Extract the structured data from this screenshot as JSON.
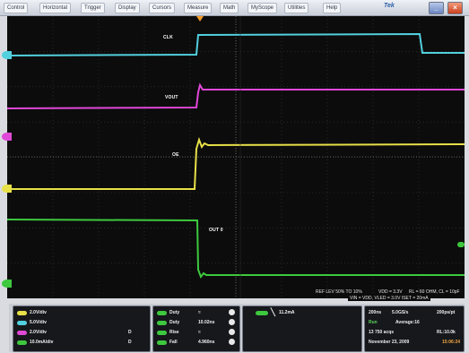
{
  "menu": {
    "items": [
      "Control",
      "Horizontal",
      "Trigger",
      "Display",
      "Cursors",
      "Measure",
      "Math",
      "MyScope",
      "Utilities",
      "Help"
    ],
    "brand": "Tek"
  },
  "colors": {
    "ch1": "#52d0de",
    "ch2": "#e048d8",
    "ch3": "#e8e048",
    "ch4": "#3ec83e"
  },
  "traces": {
    "clk_label": "CLK",
    "vout_label": "VOUT",
    "oe_label": "OE",
    "out_label": "OUT 0"
  },
  "notes": {
    "ref_lev": "REF LEV 50% TO 10%",
    "vdd": "VDD = 3.3V",
    "rl": "RL = 60 OHM, CL = 10pF",
    "vin": "VIN = VDD, VLED = 3.0V  ISET = 20mA"
  },
  "channels": [
    {
      "scale": "2.0V/div",
      "tag": ""
    },
    {
      "scale": "5.0V/div",
      "tag": ""
    },
    {
      "scale": "2.0V/div",
      "tag": "D"
    },
    {
      "scale": "10.0mA/div",
      "tag": "D"
    }
  ],
  "measurements": [
    {
      "name": "Duty",
      "value": "≈"
    },
    {
      "name": "Duty",
      "value": "10.02ns"
    },
    {
      "name": "Rise",
      "value": "≈"
    },
    {
      "name": "Fall",
      "value": "4.960ns"
    }
  ],
  "trigger": {
    "value": "11.2mA"
  },
  "acquisition": {
    "timebase": "200ns",
    "sample_rate": "5.0GS/s",
    "pts_per_div": "200ps/pt",
    "mode": "Run",
    "average": "Average:16",
    "acqs": "13 750 acqs",
    "record_length": "RL:10.0k",
    "date": "November 23, 2009",
    "time": "15:06:24"
  }
}
